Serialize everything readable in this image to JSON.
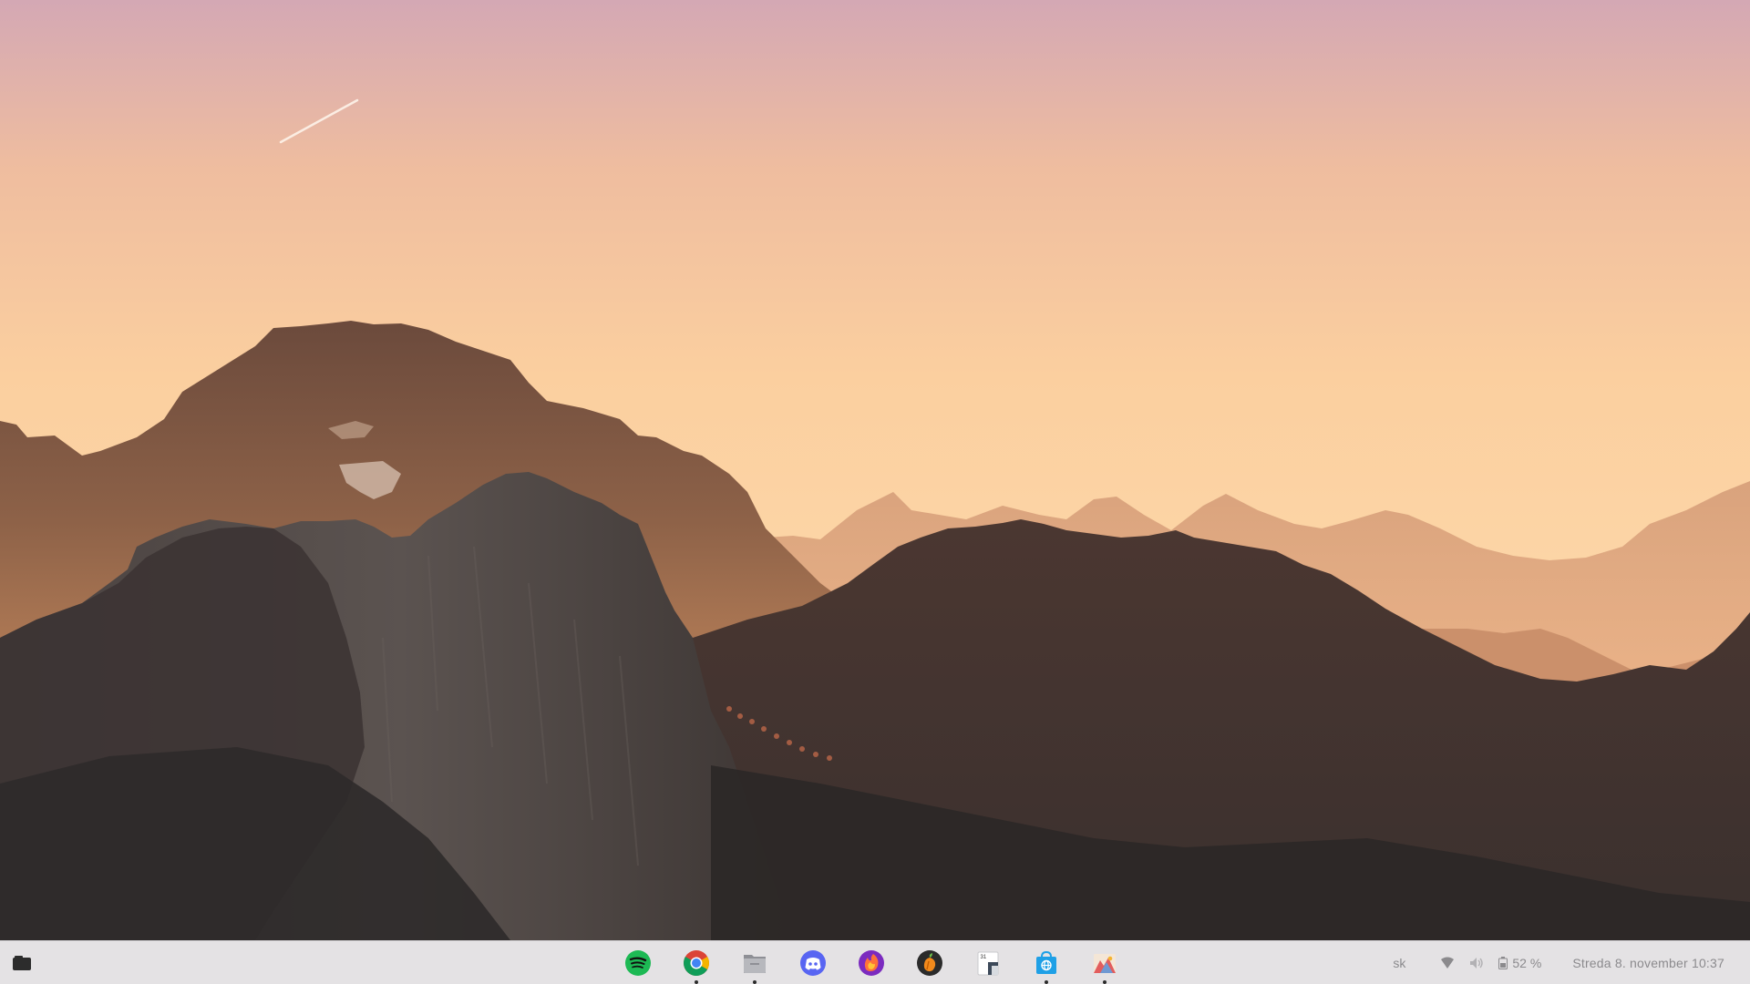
{
  "wallpaper": {
    "description_icon": "mountain-sunset-wallpaper",
    "colors": {
      "sky_top": "#d5a9b2",
      "sky_mid": "#f7c49a",
      "sky_low": "#fcd6a8",
      "rock_dark": "#2f2b2b"
    }
  },
  "taskbar": {
    "overview_button_icon": "overview-icon",
    "apps": [
      {
        "name": "Spotify",
        "icon": "spotify-icon",
        "running": false
      },
      {
        "name": "Google Chrome",
        "icon": "chrome-icon",
        "running": true
      },
      {
        "name": "Files",
        "icon": "files-icon",
        "running": true
      },
      {
        "name": "Discord",
        "icon": "discord-icon",
        "running": false
      },
      {
        "name": "Firefox",
        "icon": "firefox-icon",
        "running": false
      },
      {
        "name": "FL Studio",
        "icon": "fl-studio-icon",
        "running": false
      },
      {
        "name": "Calendar",
        "icon": "calendar-icon",
        "running": false
      },
      {
        "name": "Software Store",
        "icon": "store-icon",
        "running": true
      },
      {
        "name": "Image Viewer",
        "icon": "image-viewer-icon",
        "running": true
      }
    ],
    "tray": {
      "language": "sk",
      "battery_percent": "52 %",
      "datetime": "Streda  8. november  10:37"
    }
  }
}
